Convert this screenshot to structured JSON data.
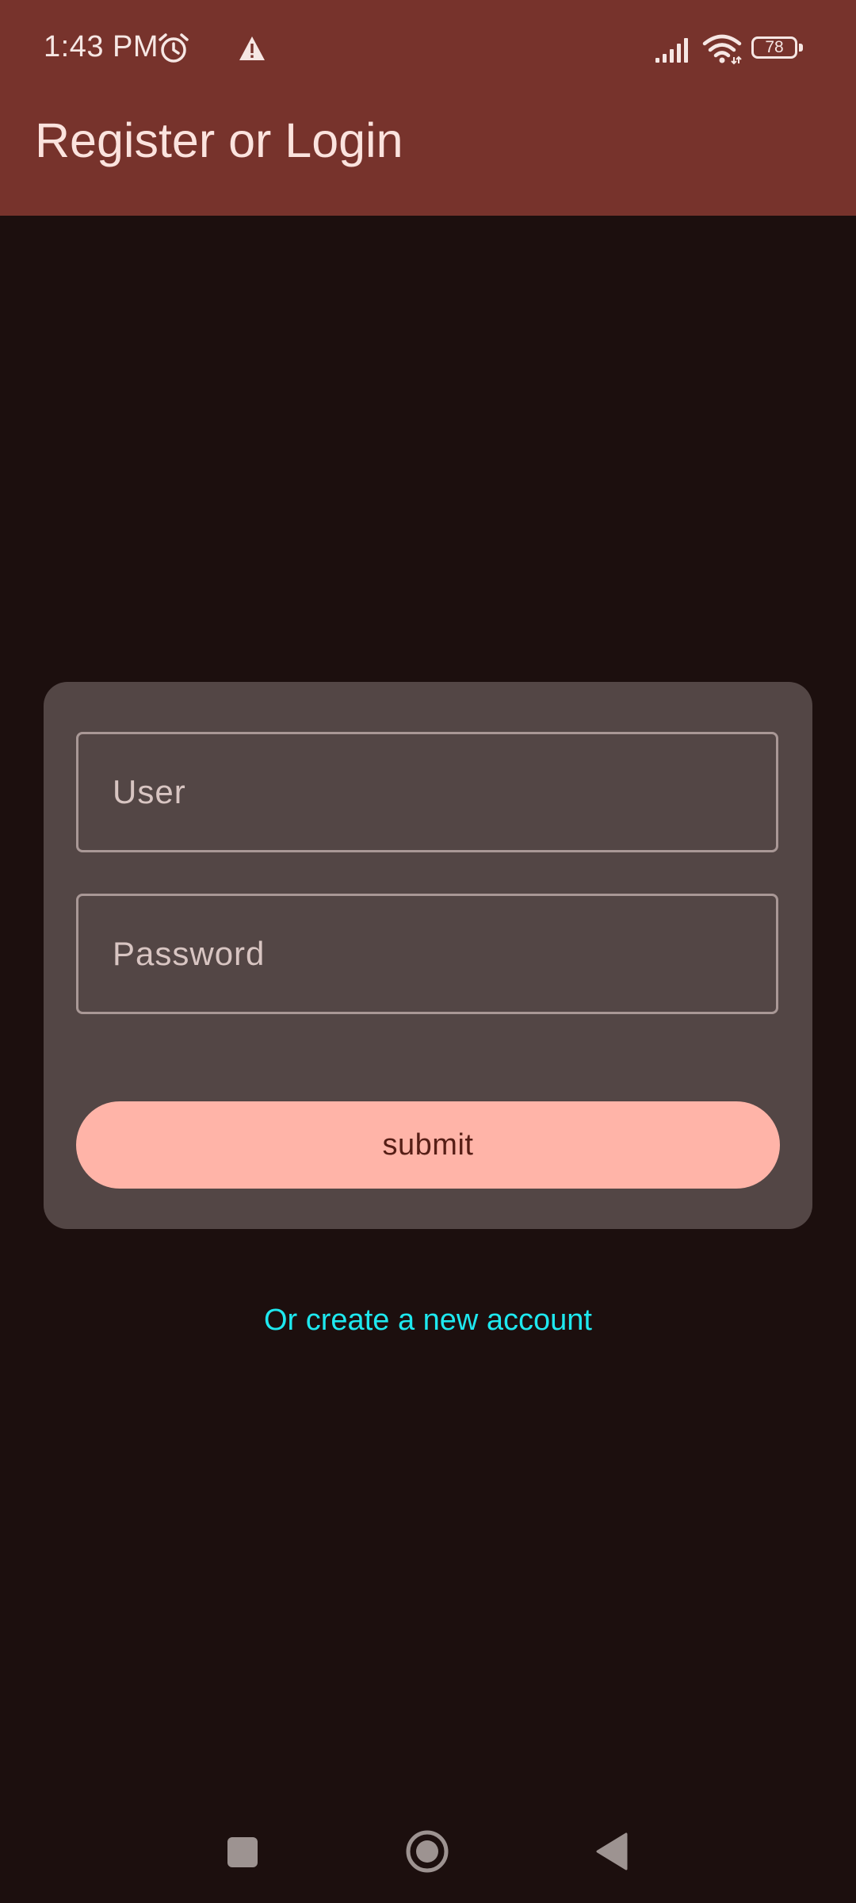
{
  "status_bar": {
    "time": "1:43 PM",
    "battery_level": "78",
    "icons": [
      "alarm-icon",
      "warning-icon",
      "signal-icon",
      "wifi-icon",
      "battery-icon"
    ]
  },
  "app_bar": {
    "title": "Register or Login"
  },
  "login_form": {
    "user_placeholder": "User",
    "user_value": "",
    "password_placeholder": "Password",
    "password_value": "",
    "submit_label": "submit"
  },
  "create_account_link": "Or create a new account",
  "navigation_bar": {
    "icons": [
      "recents-icon",
      "home-icon",
      "back-icon"
    ]
  },
  "colors": {
    "app_bar": "#77332c",
    "background": "#1c0f0e",
    "card": "#534645",
    "submit_button": "#ffb4a8",
    "link": "#1ee8ef"
  }
}
